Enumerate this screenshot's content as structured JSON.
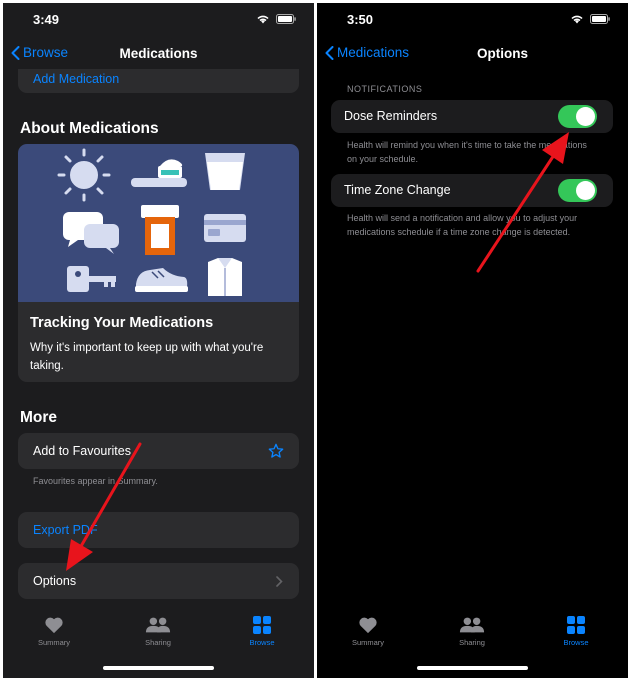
{
  "left": {
    "status": {
      "time": "3:49"
    },
    "nav": {
      "back_label": "Browse",
      "title": "Medications"
    },
    "add_medication": "Add Medication",
    "about_title": "About Medications",
    "article": {
      "title": "Tracking Your Medications",
      "body": "Why it's important to keep up with what you're taking."
    },
    "more_title": "More",
    "favourites": {
      "label": "Add to Favourites",
      "note": "Favourites appear in Summary."
    },
    "export_pdf": "Export PDF",
    "options_label": "Options",
    "tabs": [
      {
        "label": "Summary",
        "icon": "heart-icon"
      },
      {
        "label": "Sharing",
        "icon": "people-icon"
      },
      {
        "label": "Browse",
        "icon": "grid-icon"
      }
    ]
  },
  "right": {
    "status": {
      "time": "3:50"
    },
    "nav": {
      "back_label": "Medications",
      "title": "Options"
    },
    "section_header": "NOTIFICATIONS",
    "dose_reminders": {
      "label": "Dose Reminders",
      "enabled": true,
      "description": "Health will remind you when it's time to take the medications on your schedule."
    },
    "time_zone": {
      "label": "Time Zone Change",
      "enabled": true,
      "description": "Health will send a notification and allow you to adjust your medications schedule if a time zone change is detected."
    },
    "tabs": [
      {
        "label": "Summary",
        "icon": "heart-icon"
      },
      {
        "label": "Sharing",
        "icon": "people-icon"
      },
      {
        "label": "Browse",
        "icon": "grid-icon"
      }
    ]
  },
  "colors": {
    "accent": "#0a84ff",
    "toggle_on": "#34c759",
    "annotation_arrow": "#e8141c",
    "illustration_bg": "#3b4a7a"
  }
}
